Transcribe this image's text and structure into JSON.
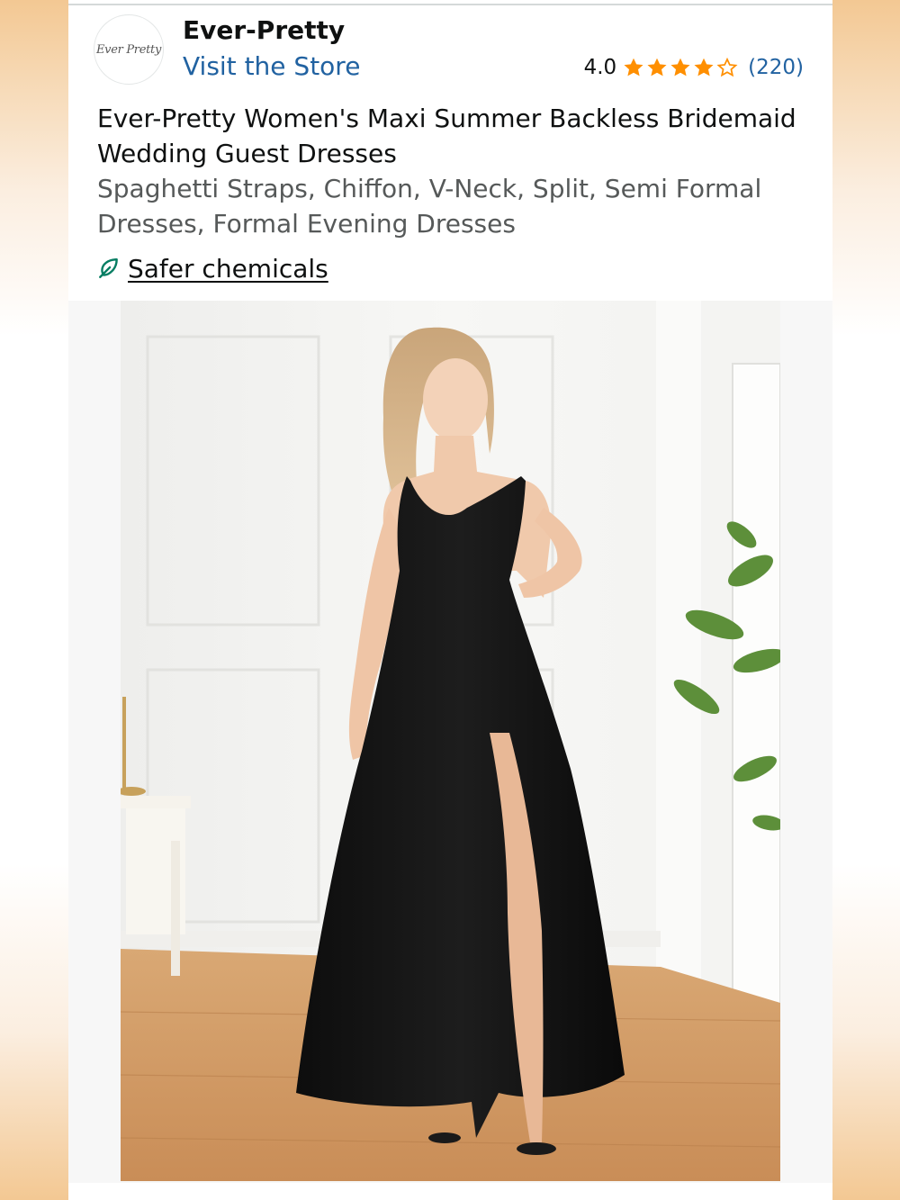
{
  "brand": {
    "logo_text": "Ever Pretty",
    "name": "Ever-Pretty",
    "store_link": "Visit the Store"
  },
  "rating": {
    "value": "4.0",
    "stars": 4,
    "max_stars": 5,
    "count": "(220)",
    "star_color": "#ff8f00"
  },
  "product": {
    "title": "Ever-Pretty Women's Maxi Summer Backless Bridemaid Wedding Guest Dresses",
    "subtitle": "Spaghetti Straps, Chiffon, V-Neck, Split, Semi Formal Dresses, Formal Evening Dresses"
  },
  "badge": {
    "icon": "leaf-icon",
    "label": "Safer chemicals",
    "color": "#067d62"
  },
  "colors": {
    "link": "#2162a1",
    "text": "#0f1111",
    "muted": "#565959"
  }
}
